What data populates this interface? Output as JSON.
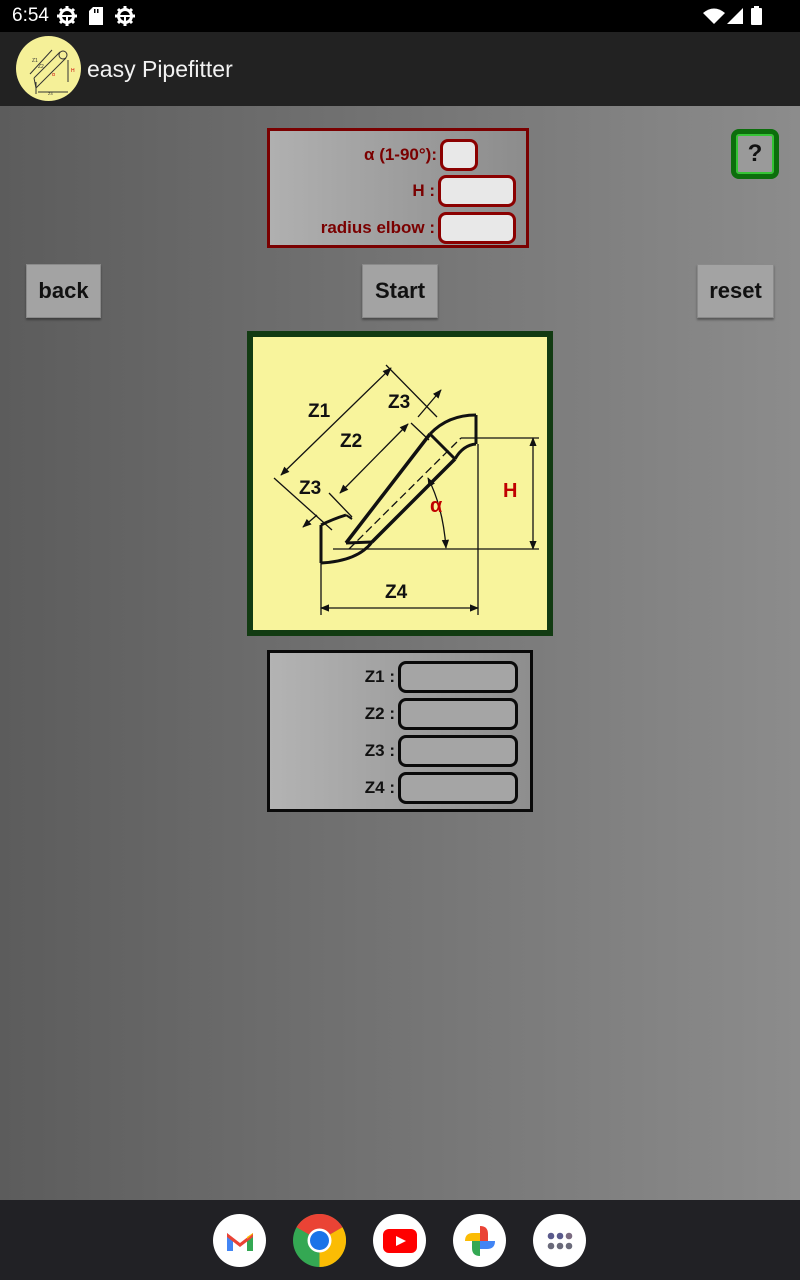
{
  "status_bar": {
    "time": "6:54",
    "left_icons": [
      "settings-gear-icon",
      "sd-card-icon",
      "settings-gear-icon"
    ],
    "right_icons": [
      "wifi-icon",
      "cell-signal-icon",
      "battery-icon"
    ]
  },
  "app_bar": {
    "title": "easy Pipefitter",
    "logo": "pipe-elbow-diagram-logo"
  },
  "inputs": {
    "alpha": {
      "label": "α (1-90°):",
      "value": ""
    },
    "h": {
      "label": "H :",
      "value": ""
    },
    "radius": {
      "label": "radius elbow :",
      "value": ""
    }
  },
  "help_button": {
    "label": "?"
  },
  "buttons": {
    "back": "back",
    "start": "Start",
    "reset": "reset"
  },
  "diagram": {
    "labels": {
      "z1": "Z1",
      "z2": "Z2",
      "z3_top": "Z3",
      "z3_bottom": "Z3",
      "z4": "Z4",
      "h": "H",
      "alpha": "α"
    }
  },
  "outputs": [
    {
      "label": "Z1 :",
      "value": ""
    },
    {
      "label": "Z2 :",
      "value": ""
    },
    {
      "label": "Z3 :",
      "value": ""
    },
    {
      "label": "Z4 :",
      "value": ""
    }
  ],
  "dock": [
    "gmail-icon",
    "chrome-icon",
    "youtube-icon",
    "photos-icon",
    "app-drawer-icon"
  ],
  "colors": {
    "input_border": "#7a0000",
    "help_border": "#0c6e0c",
    "diagram_bg": "#f8f49c",
    "diagram_frame": "#123b12",
    "accent_red": "#c00000"
  }
}
